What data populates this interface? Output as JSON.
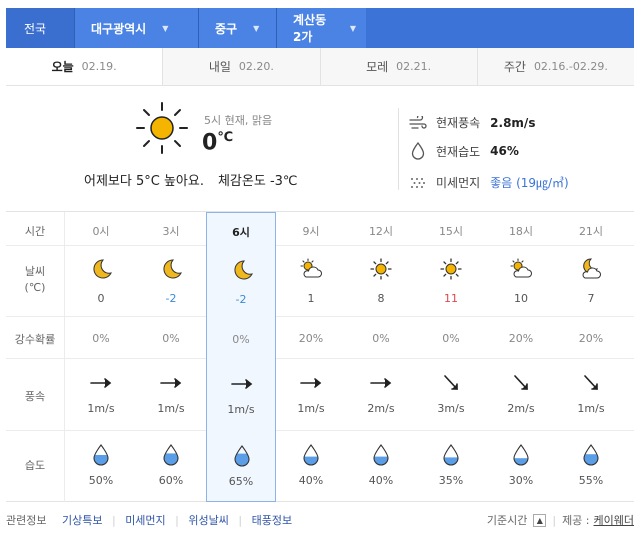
{
  "location": {
    "home": "전국",
    "segments": [
      "대구광역시",
      "중구",
      "계산동2가"
    ]
  },
  "day_tabs": [
    {
      "label": "오늘",
      "date": "02.19."
    },
    {
      "label": "내일",
      "date": "02.20."
    },
    {
      "label": "모레",
      "date": "02.21."
    },
    {
      "label": "주간",
      "date": "02.16.-02.29."
    }
  ],
  "current": {
    "time_status": "5시 현재, 맑음",
    "temp": "0",
    "temp_unit": "℃",
    "compare": "어제보다 5°C 높아요.",
    "feels_like": "체감온도 -3℃",
    "wind_label": "현재풍속",
    "wind_value": "2.8m/s",
    "humidity_label": "현재습도",
    "humidity_value": "46%",
    "dust_label": "미세먼지",
    "dust_value": "좋음 (19㎍/㎥)"
  },
  "hourly_labels": {
    "time": "시간",
    "weather": "날씨",
    "weather_unit": "(℃)",
    "rain": "강수확률",
    "wind": "풍속",
    "humidity": "습도"
  },
  "hourly": [
    {
      "time": "0시",
      "icon": "moon-icon",
      "temp": "0",
      "rain": "0%",
      "wind_dir": "east",
      "wind": "1m/s",
      "humidity": "50%",
      "humidity_level": 0.5
    },
    {
      "time": "3시",
      "icon": "moon-icon",
      "temp": "-2",
      "rain": "0%",
      "wind_dir": "east",
      "wind": "1m/s",
      "humidity": "60%",
      "humidity_level": 0.6
    },
    {
      "time": "6시",
      "icon": "moon-icon",
      "temp": "-2",
      "rain": "0%",
      "wind_dir": "east",
      "wind": "1m/s",
      "humidity": "65%",
      "humidity_level": 0.65
    },
    {
      "time": "9시",
      "icon": "sun-cloud-icon",
      "temp": "1",
      "rain": "20%",
      "wind_dir": "east",
      "wind": "1m/s",
      "humidity": "40%",
      "humidity_level": 0.4
    },
    {
      "time": "12시",
      "icon": "sun-icon",
      "temp": "8",
      "rain": "0%",
      "wind_dir": "east",
      "wind": "2m/s",
      "humidity": "40%",
      "humidity_level": 0.4
    },
    {
      "time": "15시",
      "icon": "sun-icon",
      "temp": "11",
      "rain": "0%",
      "wind_dir": "southeast",
      "wind": "3m/s",
      "humidity": "35%",
      "humidity_level": 0.35
    },
    {
      "time": "18시",
      "icon": "sun-cloud-icon",
      "temp": "10",
      "rain": "20%",
      "wind_dir": "southeast",
      "wind": "2m/s",
      "humidity": "30%",
      "humidity_level": 0.3
    },
    {
      "time": "21시",
      "icon": "moon-cloud-icon",
      "temp": "7",
      "rain": "20%",
      "wind_dir": "southeast",
      "wind": "1m/s",
      "humidity": "55%",
      "humidity_level": 0.55
    }
  ],
  "footer": {
    "related_label": "관련정보",
    "links": [
      "기상특보",
      "미세먼지",
      "위성날씨",
      "태풍정보"
    ],
    "base_time_label": "기준시간",
    "provider_label": "제공 :",
    "provider": "케이웨더"
  },
  "colors": {
    "accent": "#3c73d6",
    "cold": "#3a8bd8",
    "warm": "#e0484c",
    "sun": "#f5b400",
    "moon": "#f0b81f",
    "water": "#5a9ee8"
  }
}
